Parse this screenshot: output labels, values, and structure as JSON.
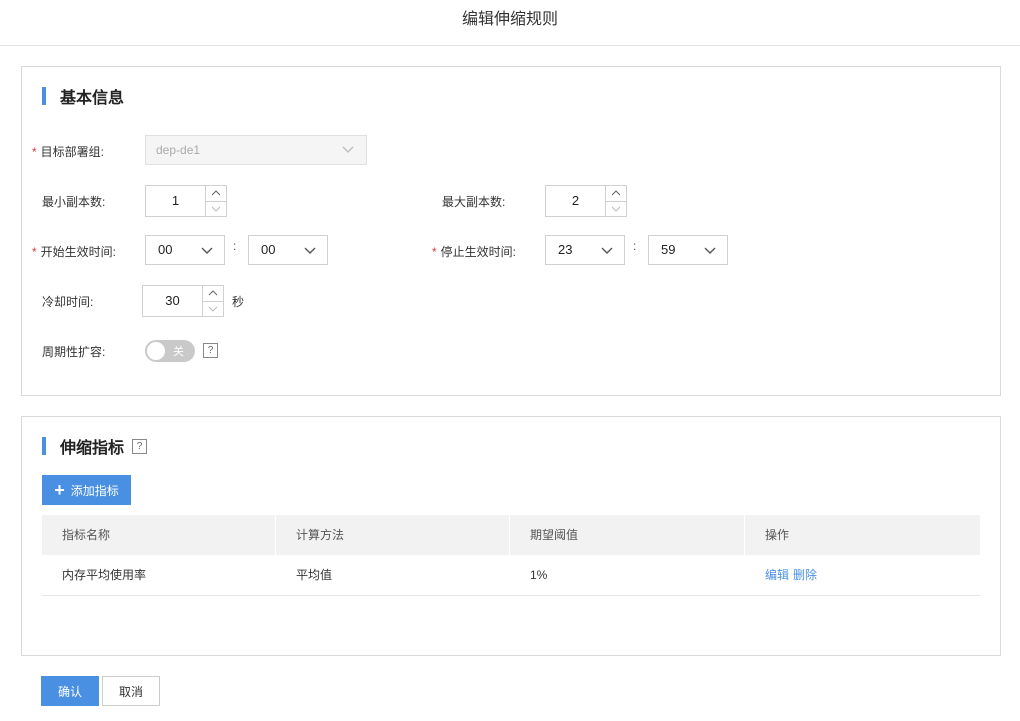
{
  "header": {
    "title": "编辑伸缩规则"
  },
  "basic": {
    "section_title": "基本信息",
    "deploy_group": {
      "label": "目标部署组:",
      "value": "dep-de1"
    },
    "min_replicas": {
      "label": "最小副本数:",
      "value": "1"
    },
    "max_replicas": {
      "label": "最大副本数:",
      "value": "2"
    },
    "start_time": {
      "label": "开始生效时间:",
      "hour": "00",
      "minute": "00"
    },
    "stop_time": {
      "label": "停止生效时间:",
      "hour": "23",
      "minute": "59"
    },
    "time_sep": ":",
    "cooldown": {
      "label": "冷却时间:",
      "value": "30",
      "unit": "秒"
    },
    "periodic": {
      "label": "周期性扩容:",
      "toggle_text": "关",
      "help": "?"
    }
  },
  "metrics": {
    "section_title": "伸缩指标",
    "help": "?",
    "add_button": "添加指标",
    "columns": [
      "指标名称",
      "计算方法",
      "期望阈值",
      "操作"
    ],
    "rows": [
      {
        "name": "内存平均使用率",
        "method": "平均值",
        "threshold": "1%",
        "edit": "编辑",
        "delete": "删除"
      }
    ]
  },
  "footer": {
    "confirm": "确认",
    "cancel": "取消"
  },
  "colors": {
    "accent": "#4a90e2",
    "required": "#e4393c"
  }
}
